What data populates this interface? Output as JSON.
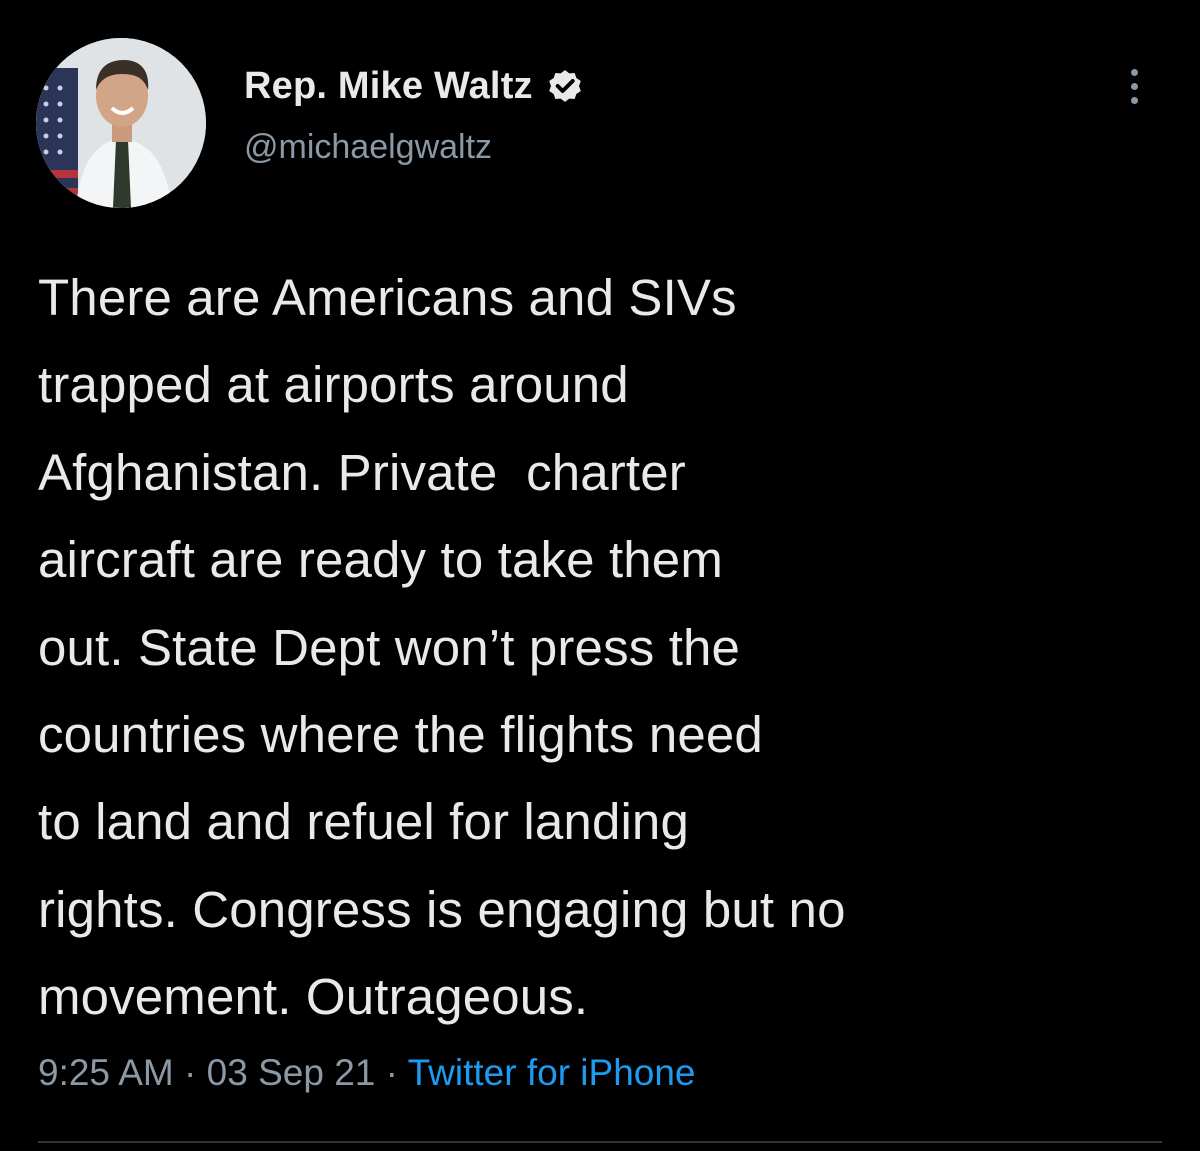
{
  "author": {
    "display_name": "Rep. Mike Waltz",
    "handle": "@michaelgwaltz",
    "verified": true
  },
  "icons": {
    "avatar": "profile-photo",
    "verified": "verified-badge-icon",
    "more": "more-options-icon"
  },
  "tweet": {
    "lines": [
      "There are Americans and SIVs",
      "trapped at airports around",
      "Afghanistan. Private  charter",
      "aircraft are ready to take them",
      "out. State Dept won’t press the",
      "countries where the flights need",
      "to land and refuel for landing",
      "rights. Congress is engaging but no",
      "movement. Outrageous."
    ]
  },
  "meta": {
    "time": "9:25 AM",
    "separator": " · ",
    "date": "03 Sep 21",
    "source": "Twitter for iPhone"
  },
  "colors": {
    "background": "#000000",
    "text": "#e7e9ea",
    "muted": "#8b98a5",
    "link": "#1d9bf0",
    "divider": "#2f3336"
  }
}
